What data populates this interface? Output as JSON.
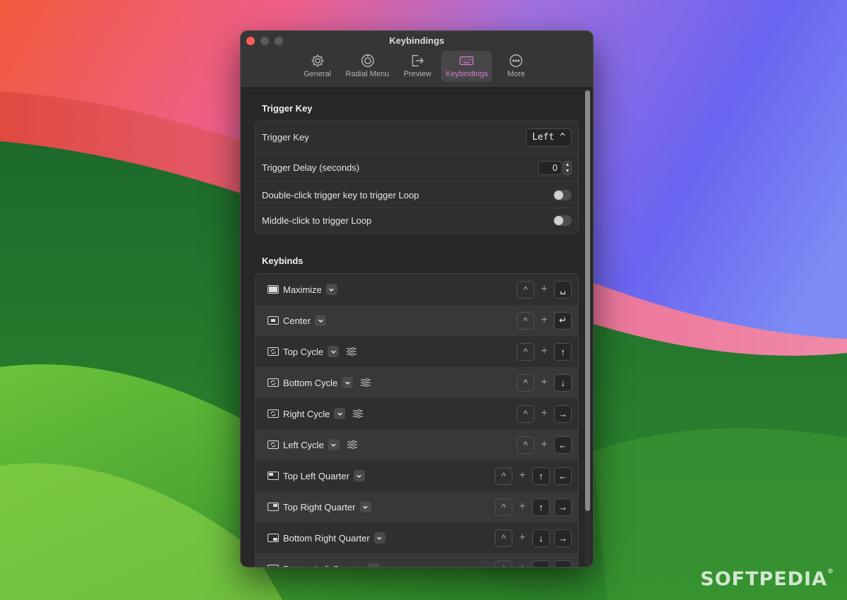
{
  "window": {
    "title": "Keybindings"
  },
  "toolbar": {
    "tabs": [
      {
        "label": "General",
        "icon": "gear-icon"
      },
      {
        "label": "Radial Menu",
        "icon": "radial-icon"
      },
      {
        "label": "Preview",
        "icon": "preview-icon"
      },
      {
        "label": "Keybindings",
        "icon": "keyboard-icon",
        "active": true
      },
      {
        "label": "More",
        "icon": "ellipsis-icon"
      }
    ],
    "accent_color": "#d47cd4"
  },
  "trigger": {
    "section_title": "Trigger Key",
    "trigger_key_label": "Trigger Key",
    "trigger_key_value": "Left",
    "trigger_key_chevron": "^",
    "delay_label": "Trigger Delay (seconds)",
    "delay_value": "0",
    "double_click_label": "Double-click trigger key to trigger Loop",
    "double_click_on": false,
    "middle_click_label": "Middle-click to trigger Loop",
    "middle_click_on": false
  },
  "keybinds": {
    "section_title": "Keybinds",
    "modifier_symbol": "^",
    "plus_symbol": "+",
    "items": [
      {
        "name": "Maximize",
        "keys": [
          "␣"
        ],
        "cycle": false
      },
      {
        "name": "Center",
        "keys": [
          "↵"
        ],
        "cycle": false
      },
      {
        "name": "Top Cycle",
        "keys": [
          "↑"
        ],
        "cycle": true
      },
      {
        "name": "Bottom Cycle",
        "keys": [
          "↓"
        ],
        "cycle": true
      },
      {
        "name": "Right Cycle",
        "keys": [
          "→"
        ],
        "cycle": true
      },
      {
        "name": "Left Cycle",
        "keys": [
          "←"
        ],
        "cycle": true
      },
      {
        "name": "Top Left Quarter",
        "keys": [
          "↑",
          "←"
        ],
        "cycle": false
      },
      {
        "name": "Top Right Quarter",
        "keys": [
          "↑",
          "→"
        ],
        "cycle": false
      },
      {
        "name": "Bottom Right Quarter",
        "keys": [
          "↓",
          "→"
        ],
        "cycle": false
      },
      {
        "name": "Bottom Left Quarter",
        "keys": [
          "↓",
          "←"
        ],
        "cycle": false
      }
    ]
  },
  "watermark": {
    "text": "SOFTPEDIA",
    "mark": "®"
  }
}
